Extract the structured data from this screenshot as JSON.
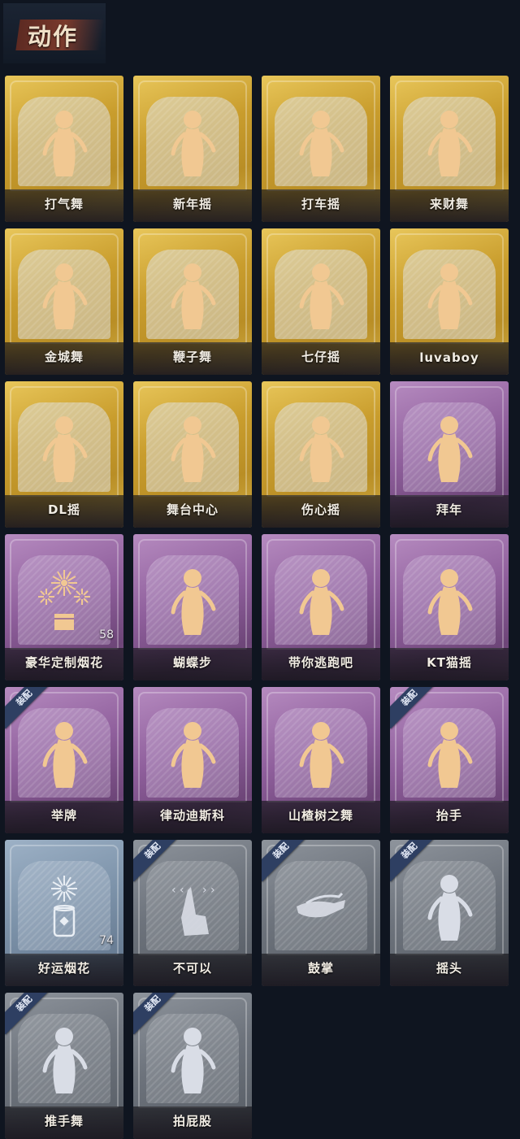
{
  "header": {
    "title": "动作"
  },
  "cards": [
    {
      "label": "打气舞",
      "tier": "gold"
    },
    {
      "label": "新年摇",
      "tier": "gold"
    },
    {
      "label": "打车摇",
      "tier": "gold"
    },
    {
      "label": "来财舞",
      "tier": "gold"
    },
    {
      "label": "金城舞",
      "tier": "gold"
    },
    {
      "label": "鞭子舞",
      "tier": "gold"
    },
    {
      "label": "七仔摇",
      "tier": "gold"
    },
    {
      "label": "luvaboy",
      "tier": "gold"
    },
    {
      "label": "DL摇",
      "tier": "gold"
    },
    {
      "label": "舞台中心",
      "tier": "gold"
    },
    {
      "label": "伤心摇",
      "tier": "gold"
    },
    {
      "label": "拜年",
      "tier": "purple"
    },
    {
      "label": "豪华定制烟花",
      "tier": "purple",
      "count": "58",
      "icon": "fireworks-icon"
    },
    {
      "label": "蝴蝶步",
      "tier": "purple"
    },
    {
      "label": "带你逃跑吧",
      "tier": "purple"
    },
    {
      "label": "KT猫摇",
      "tier": "purple"
    },
    {
      "label": "举牌",
      "tier": "purple",
      "badge": "装配"
    },
    {
      "label": "律动迪斯科",
      "tier": "purple"
    },
    {
      "label": "山楂树之舞",
      "tier": "purple"
    },
    {
      "label": "抬手",
      "tier": "purple",
      "badge": "装配"
    },
    {
      "label": "好运烟花",
      "tier": "blue",
      "count": "74",
      "icon": "firework-can-icon"
    },
    {
      "label": "不可以",
      "tier": "gray",
      "badge": "装配",
      "icon": "finger-wag-icon"
    },
    {
      "label": "鼓掌",
      "tier": "gray",
      "badge": "装配",
      "icon": "clap-icon"
    },
    {
      "label": "摇头",
      "tier": "gray",
      "badge": "装配"
    },
    {
      "label": "推手舞",
      "tier": "gray",
      "badge": "装配"
    },
    {
      "label": "拍屁股",
      "tier": "gray",
      "badge": "装配"
    }
  ],
  "colors": {
    "gold": "#c99d2d",
    "purple": "#8f5f9c",
    "blue": "#7d93aa",
    "gray": "#6d737c",
    "badge": "#2e3f62",
    "background": "#0f1520"
  }
}
